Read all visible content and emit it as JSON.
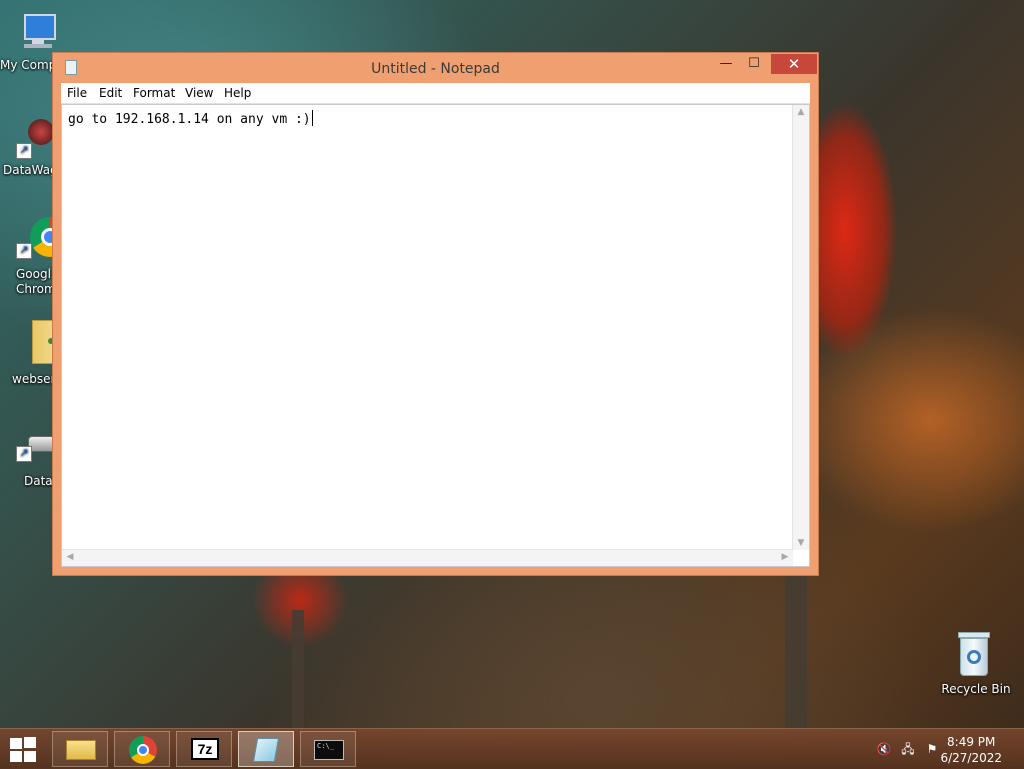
{
  "desktop": {
    "icons": [
      {
        "label": "My Comp"
      },
      {
        "label": "DataWag"
      },
      {
        "label": "Googl\nChrom"
      },
      {
        "label": "webserv"
      },
      {
        "label": "Datas"
      }
    ],
    "recycle_bin": {
      "label": "Recycle Bin"
    }
  },
  "notepad": {
    "title": "Untitled - Notepad",
    "menu": [
      "File",
      "Edit",
      "Format",
      "View",
      "Help"
    ],
    "content": "go to 192.168.1.14 on any vm :)",
    "caption": {
      "minimize": "—",
      "maximize": "☐",
      "close": "✕"
    }
  },
  "taskbar": {
    "apps": [
      {
        "name": "File Explorer",
        "icon": "folder-icon"
      },
      {
        "name": "Google Chrome",
        "icon": "chrome-icon"
      },
      {
        "name": "7-Zip",
        "icon": "7zip-icon",
        "glyph": "7z"
      },
      {
        "name": "Notepad",
        "icon": "notepad-icon",
        "active": true
      },
      {
        "name": "Command Prompt",
        "icon": "cmd-icon",
        "glyph": "C:\\_"
      }
    ],
    "clock": {
      "time": "8:49 PM",
      "date": "6/27/2022"
    }
  },
  "colors": {
    "window_frame": "#f0a070",
    "close_button": "#c7473a"
  }
}
